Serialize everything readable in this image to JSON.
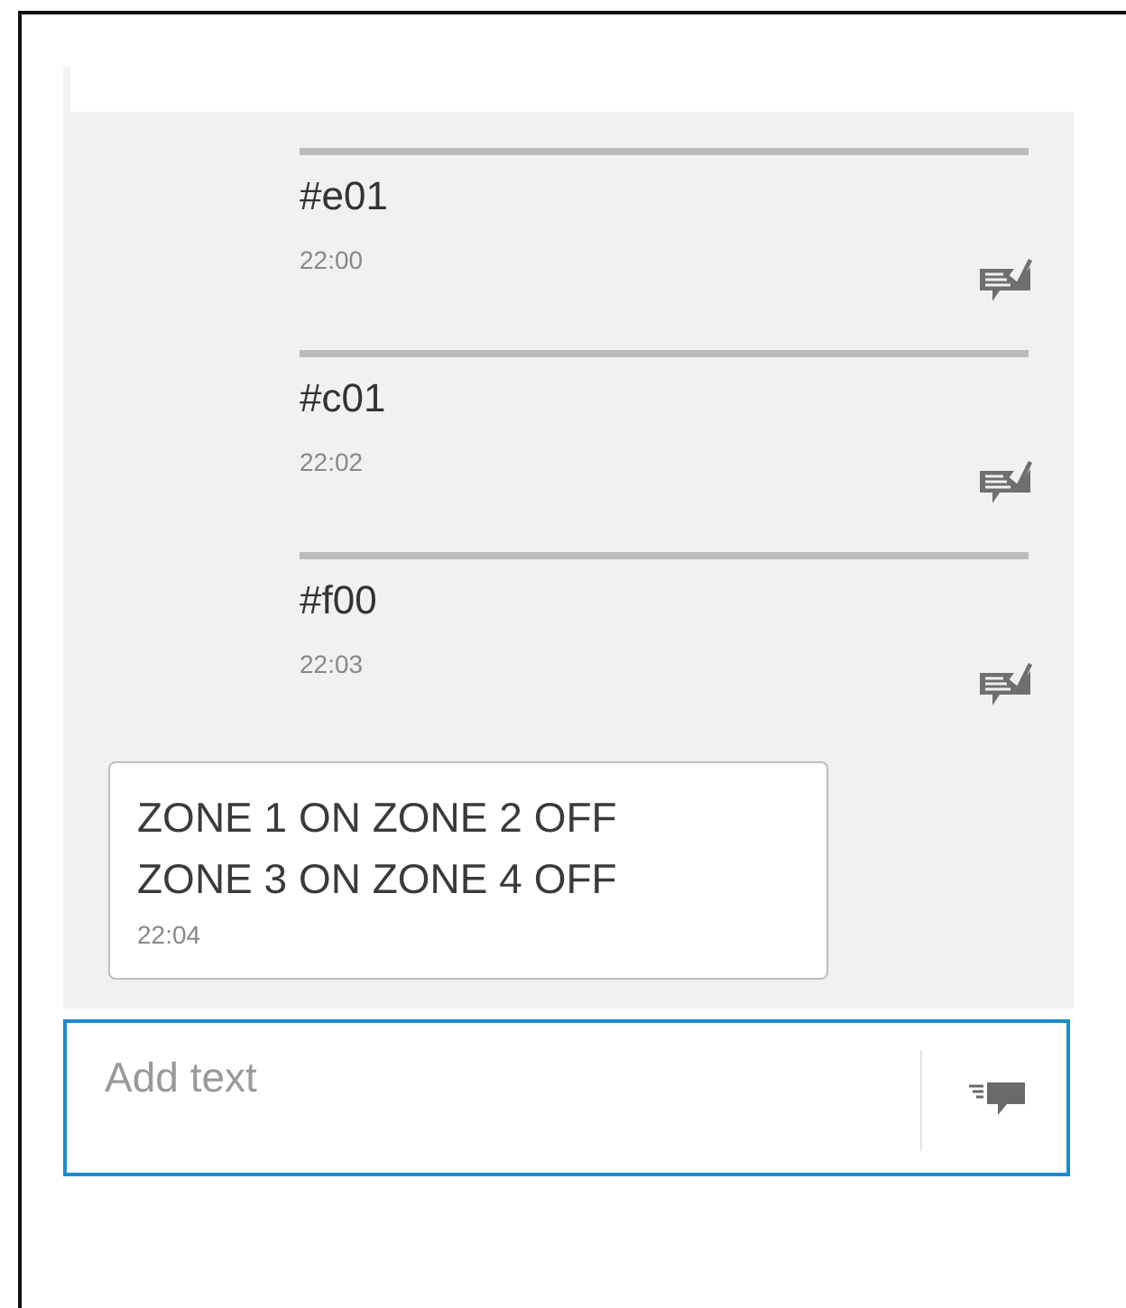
{
  "messages": [
    {
      "kind": "sent",
      "text": "#e01",
      "time": "22:00"
    },
    {
      "kind": "sent",
      "text": "#c01",
      "time": "22:02"
    },
    {
      "kind": "sent",
      "text": "#f00",
      "time": "22:03"
    },
    {
      "kind": "received",
      "text": "ZONE 1 ON ZONE 2 OFF\nZONE 3 ON ZONE 4 OFF",
      "time": "22:04"
    }
  ],
  "composer": {
    "placeholder": "Add text"
  }
}
